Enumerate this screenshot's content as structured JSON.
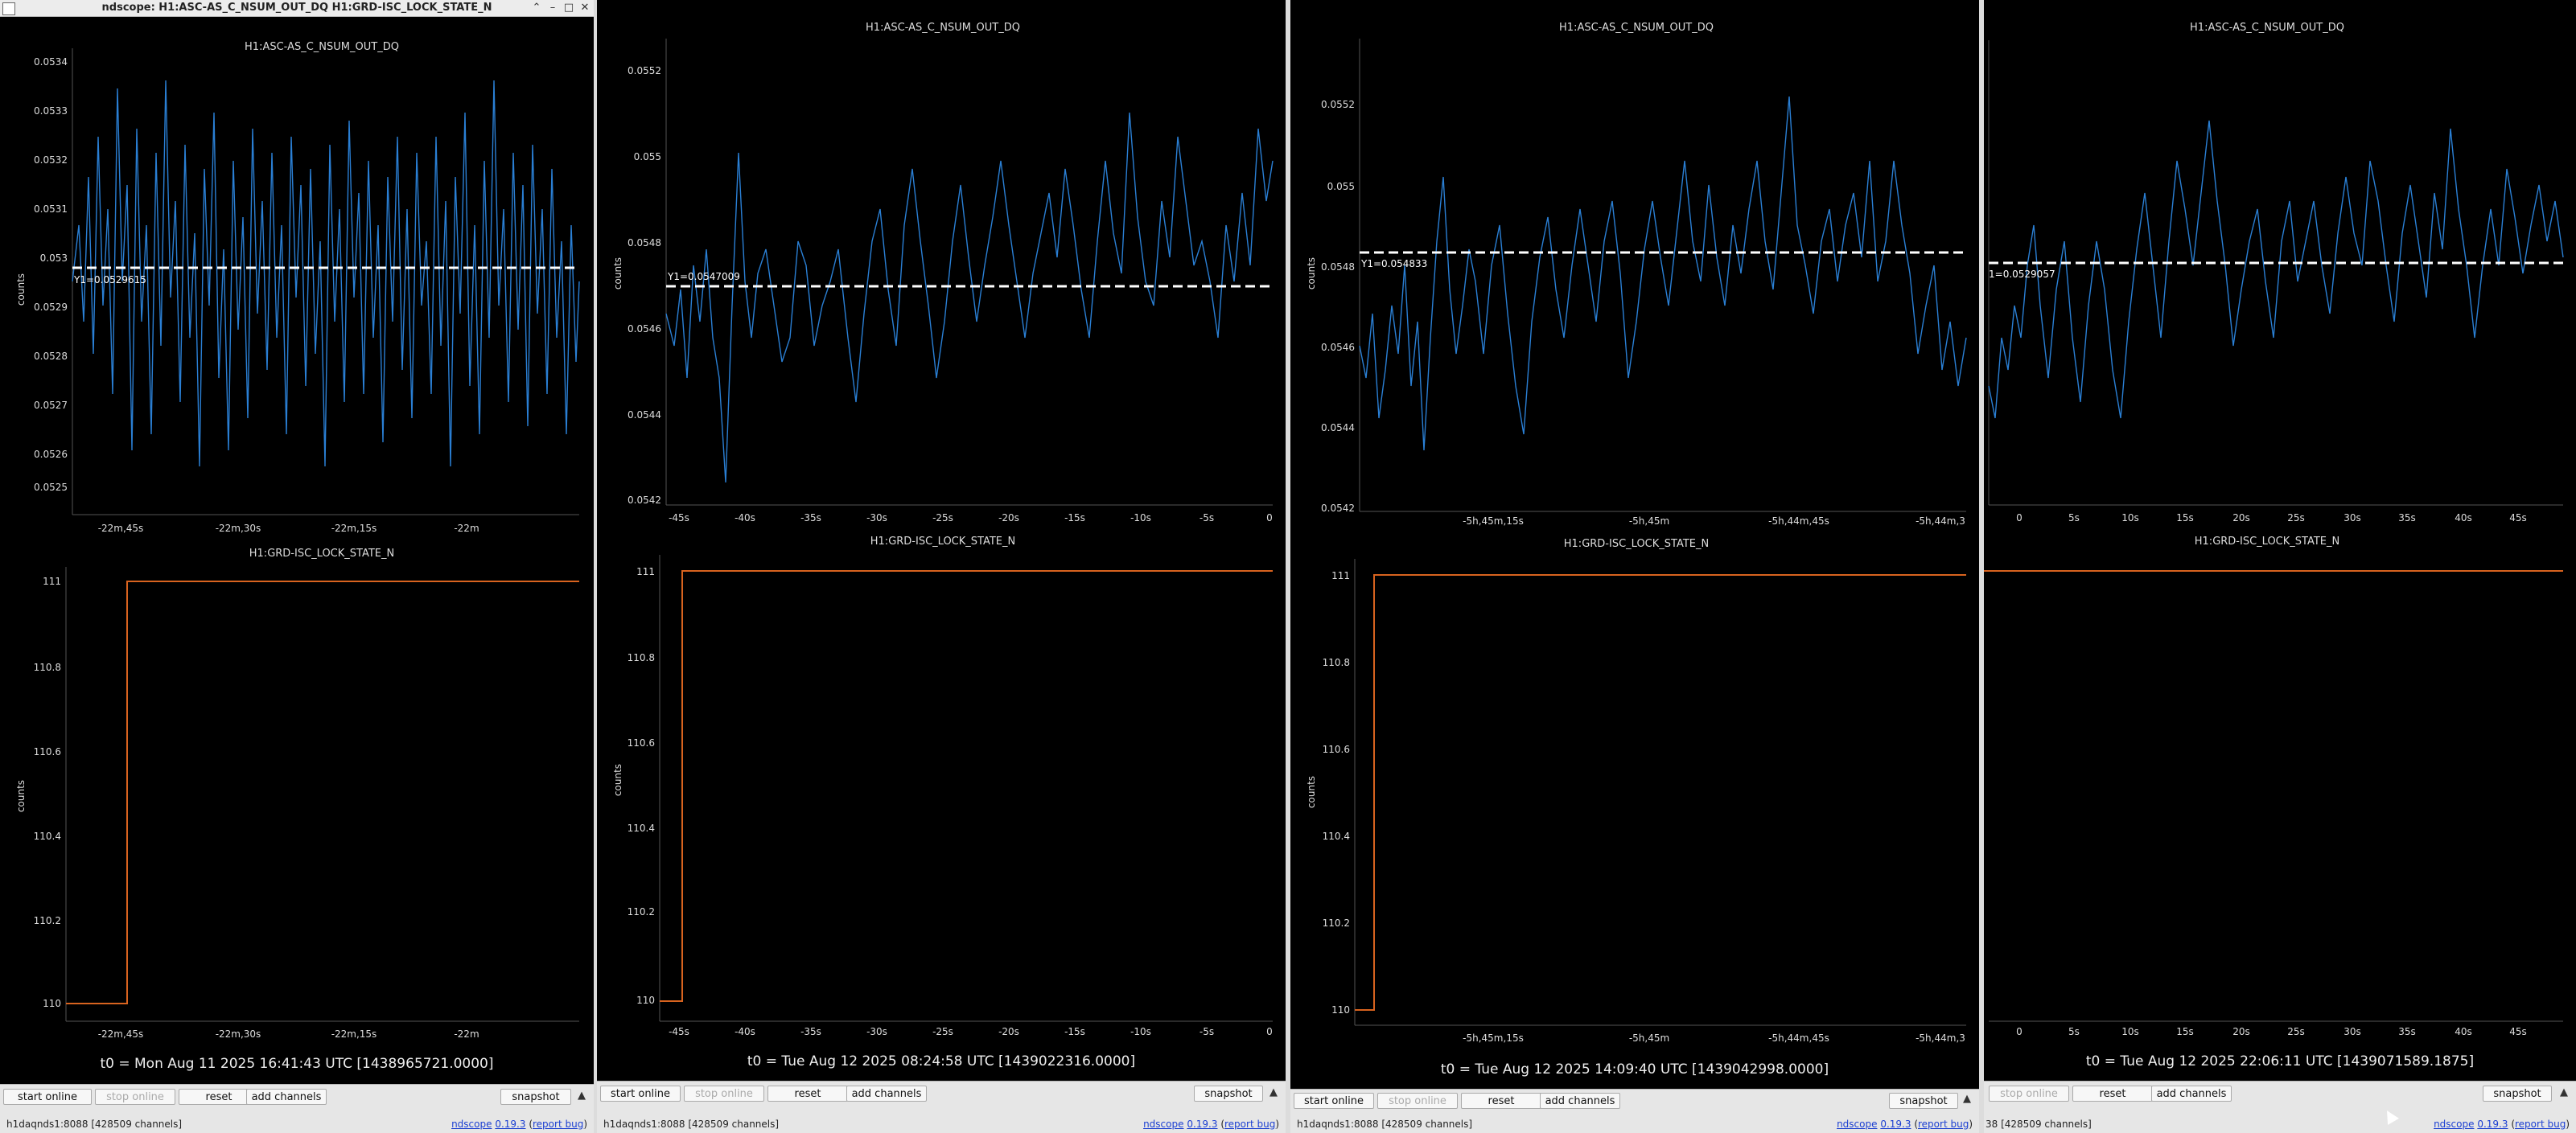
{
  "window_title": "ndscope: H1:ASC-AS_C_NSUM_OUT_DQ H1:GRD-ISC_LOCK_STATE_N",
  "title_buttons": [
    "⌃",
    "–",
    "□",
    "✕"
  ],
  "colors": {
    "plot_bg": "#000000",
    "trace_top": "#2a7fd4",
    "trace_bottom": "#d8631f",
    "cursor_line": "#ffffff",
    "grid": "#2a2a2a"
  },
  "panels": [
    {
      "top_title": "H1:ASC-AS_C_NSUM_OUT_DQ",
      "top_ylabel": "counts",
      "top_yticks": [
        "0.0534",
        "0.0533",
        "0.0532",
        "0.0531",
        "0.053",
        "0.0529",
        "0.0528",
        "0.0527",
        "0.0526",
        "0.0525"
      ],
      "top_xticks": [
        "-22m,45s",
        "-22m,30s",
        "-22m,15s",
        "-22m"
      ],
      "cursor_label": "Y1=0.0529615",
      "bottom_title": "H1:GRD-ISC_LOCK_STATE_N",
      "bottom_ylabel": "counts",
      "bottom_yticks": [
        "111",
        "110.8",
        "110.6",
        "110.4",
        "110.2",
        "110"
      ],
      "bottom_xticks": [
        "-22m,45s",
        "-22m,30s",
        "-22m,15s",
        "-22m"
      ],
      "t0": "t0 = Mon Aug 11 2025 16:41:43 UTC [1438965721.0000]",
      "buttons": {
        "start": "start online",
        "stop": "stop online",
        "reset": "reset",
        "add": "add channels",
        "snapshot": "snapshot"
      },
      "status_left": "h1daqnds1:8088  [428509 channels]",
      "status_version_prefix": "ndscope",
      "status_version": "0.19.3",
      "status_report": "report bug"
    },
    {
      "top_title": "H1:ASC-AS_C_NSUM_OUT_DQ",
      "top_ylabel": "counts",
      "top_yticks": [
        "0.0552",
        "0.055",
        "0.0548",
        "0.0546",
        "0.0544",
        "0.0542"
      ],
      "top_xticks": [
        "-45s",
        "-40s",
        "-35s",
        "-30s",
        "-25s",
        "-20s",
        "-15s",
        "-10s",
        "-5s",
        "0"
      ],
      "cursor_label": "Y1=0.0547009",
      "bottom_title": "H1:GRD-ISC_LOCK_STATE_N",
      "bottom_ylabel": "counts",
      "bottom_yticks": [
        "111",
        "110.8",
        "110.6",
        "110.4",
        "110.2",
        "110"
      ],
      "bottom_xticks": [
        "-45s",
        "-40s",
        "-35s",
        "-30s",
        "-25s",
        "-20s",
        "-15s",
        "-10s",
        "-5s",
        "0"
      ],
      "t0": "t0 = Tue Aug 12 2025 08:24:58 UTC [1439022316.0000]",
      "buttons": {
        "start": "start online",
        "stop": "stop online",
        "reset": "reset",
        "add": "add channels",
        "snapshot": "snapshot"
      },
      "status_left": "h1daqnds1:8088  [428509 channels]",
      "status_version_prefix": "ndscope",
      "status_version": "0.19.3",
      "status_report": "report bug"
    },
    {
      "top_title": "H1:ASC-AS_C_NSUM_OUT_DQ",
      "top_ylabel": "counts",
      "top_yticks": [
        "0.0552",
        "0.055",
        "0.0548",
        "0.0546",
        "0.0544",
        "0.0542"
      ],
      "top_xticks": [
        "-5h,45m,15s",
        "-5h,45m",
        "-5h,44m,45s",
        "-5h,44m,3"
      ],
      "cursor_label": "Y1=0.054833",
      "bottom_title": "H1:GRD-ISC_LOCK_STATE_N",
      "bottom_ylabel": "counts",
      "bottom_yticks": [
        "111",
        "110.8",
        "110.6",
        "110.4",
        "110.2",
        "110"
      ],
      "bottom_xticks": [
        "-5h,45m,15s",
        "-5h,45m",
        "-5h,44m,45s",
        "-5h,44m,3"
      ],
      "t0": "t0 = Tue Aug 12 2025 14:09:40 UTC [1439042998.0000]",
      "buttons": {
        "start": "start online",
        "stop": "stop online",
        "reset": "reset",
        "add": "add channels",
        "snapshot": "snapshot"
      },
      "status_left": "h1daqnds1:8088  [428509 channels]",
      "status_version_prefix": "ndscope",
      "status_version": "0.19.3",
      "status_report": "report bug"
    },
    {
      "top_title": "H1:ASC-AS_C_NSUM_OUT_DQ",
      "top_ylabel": "",
      "top_yticks": [],
      "top_xticks": [
        "0",
        "5s",
        "10s",
        "15s",
        "20s",
        "25s",
        "30s",
        "35s",
        "40s",
        "45s"
      ],
      "cursor_label": "1=0.0529057",
      "bottom_title": "H1:GRD-ISC_LOCK_STATE_N",
      "bottom_ylabel": "",
      "bottom_yticks": [],
      "bottom_xticks": [
        "0",
        "5s",
        "10s",
        "15s",
        "20s",
        "25s",
        "30s",
        "35s",
        "40s",
        "45s"
      ],
      "t0": "t0 = Tue Aug 12 2025 22:06:11 UTC [1439071589.1875]",
      "buttons": {
        "start": "",
        "stop": "stop online",
        "reset": "reset",
        "add": "add channels",
        "snapshot": "snapshot"
      },
      "status_left": "38  [428509 channels]",
      "status_version_prefix": "ndscope",
      "status_version": "0.19.3",
      "status_report": "report bug"
    }
  ]
}
